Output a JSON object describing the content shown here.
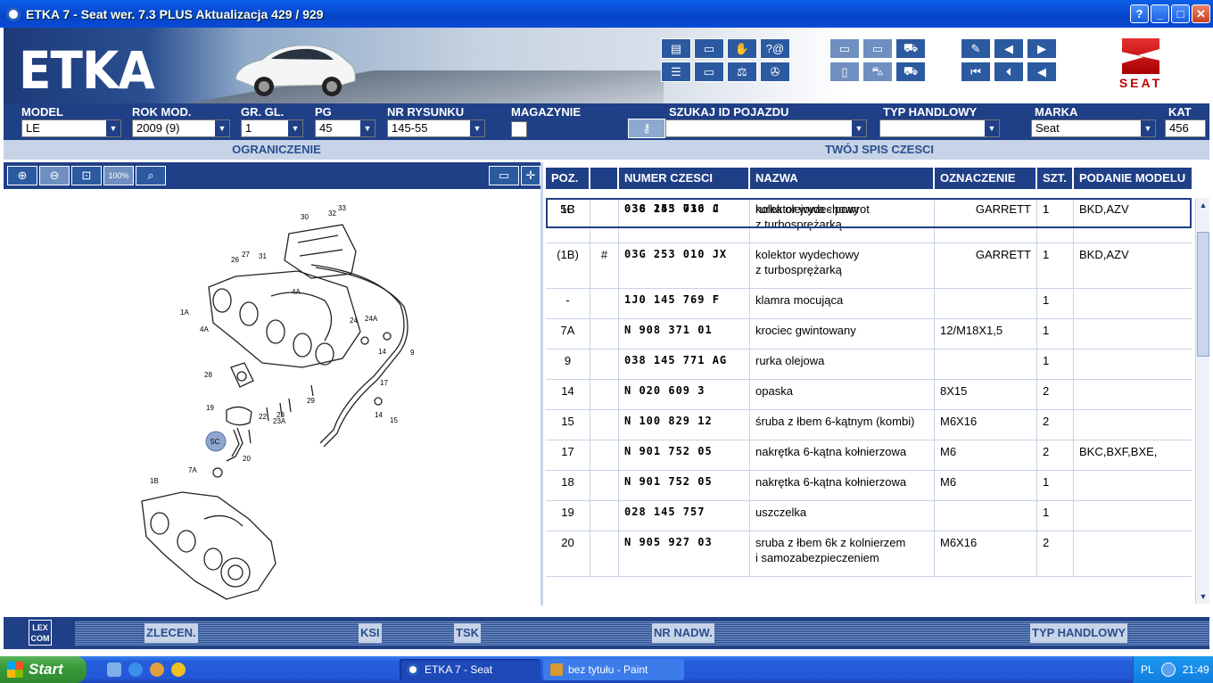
{
  "window": {
    "title": "ETKA 7 - Seat wer. 7.3 PLUS Aktualizacja 429 / 929",
    "help": "?",
    "minimize": "_",
    "maximize": "□",
    "close": "✕"
  },
  "banner": {
    "logo": "ETKA",
    "brand_word": "SEAT"
  },
  "selectors": [
    {
      "label": "MODEL",
      "value": "LE"
    },
    {
      "label": "ROK MOD.",
      "value": "2009 (9)"
    },
    {
      "label": "GR. GL.",
      "value": "1"
    },
    {
      "label": "PG",
      "value": "45"
    },
    {
      "label": "NR RYSUNKU",
      "value": "145-55"
    },
    {
      "label": "MAGAZYNIE",
      "value": ""
    },
    {
      "label": "SZUKAJ ID POJAZDU",
      "value": ""
    },
    {
      "label": "TYP HANDLOWY",
      "value": ""
    },
    {
      "label": "MARKA",
      "value": "Seat"
    },
    {
      "label": "KAT",
      "value": "456"
    }
  ],
  "subheaders": {
    "left": "OGRANICZENIE",
    "right": "TWÓJ SPIS CZESCI"
  },
  "zoom_tools": {
    "zoom100": "100%"
  },
  "table": {
    "headers": [
      "POZ.",
      "",
      "NUMER CZESCI",
      "NAZWA",
      "OZNACZENIE",
      "SZT.",
      "PODANIE MODELU"
    ],
    "rows": [
      {
        "poz": "1B",
        "mark": "",
        "num": "03G 253 010 J",
        "name": "kolektor wydechowy",
        "name2": "z turbosprężarką",
        "oznaczenie": "GARRETT",
        "szt": "1",
        "model": "BKD,AZV"
      },
      {
        "poz": "(1B)",
        "mark": "#",
        "num": "03G 253 010 JX",
        "name": "kolektor wydechowy",
        "name2": "z turbosprężarką",
        "oznaczenie": "GARRETT",
        "szt": "1",
        "model": "BKD,AZV"
      },
      {
        "poz": "-",
        "mark": "",
        "num": "1J0 145 769 F",
        "name": "klamra mocująca",
        "name2": "",
        "oznaczenie": "",
        "szt": "1",
        "model": ""
      },
      {
        "poz": "5C",
        "mark": "",
        "num": "038 145 736 C",
        "name": "rurka olejowa - powrot",
        "name2": "",
        "oznaczenie": "",
        "szt": "1",
        "model": ""
      },
      {
        "poz": "7A",
        "mark": "",
        "num": "N 908 371 01",
        "name": "krociec gwintowany",
        "name2": "",
        "oznaczenie": "12/M18X1,5",
        "szt": "1",
        "model": ""
      },
      {
        "poz": "9",
        "mark": "",
        "num": "038 145 771 AG",
        "name": "rurka olejowa",
        "name2": "",
        "oznaczenie": "",
        "szt": "1",
        "model": ""
      },
      {
        "poz": "14",
        "mark": "",
        "num": "N 020 609 3",
        "name": "opaska",
        "name2": "",
        "oznaczenie": "8X15",
        "szt": "2",
        "model": ""
      },
      {
        "poz": "15",
        "mark": "",
        "num": "N 100 829 12",
        "name": "śruba z łbem 6-kątnym (kombi)",
        "name2": "",
        "oznaczenie": "M6X16",
        "szt": "2",
        "model": ""
      },
      {
        "poz": "17",
        "mark": "",
        "num": "N 901 752 05",
        "name": "nakrętka 6-kątna kołnierzowa",
        "name2": "",
        "oznaczenie": "M6",
        "szt": "2",
        "model": "BKC,BXF,BXE,"
      },
      {
        "poz": "18",
        "mark": "",
        "num": "N 901 752 05",
        "name": "nakrętka 6-kątna kołnierzowa",
        "name2": "",
        "oznaczenie": "M6",
        "szt": "1",
        "model": ""
      },
      {
        "poz": "19",
        "mark": "",
        "num": "028 145 757",
        "name": "uszczelka",
        "name2": "",
        "oznaczenie": "",
        "szt": "1",
        "model": ""
      },
      {
        "poz": "20",
        "mark": "",
        "num": "N 905 927 03",
        "name": "sruba z łbem 6k z kolnierzem",
        "name2": "i samozabezpieczeniem",
        "oznaczenie": "M6X16",
        "szt": "2",
        "model": ""
      }
    ]
  },
  "diagram_labels": [
    "30",
    "32",
    "33",
    "26",
    "27",
    "31",
    "1A",
    "4A",
    "4A",
    "24",
    "24A",
    "14",
    "9",
    "28",
    "5C",
    "20",
    "7A",
    "19",
    "22",
    "23",
    "23A",
    "29",
    "17",
    "14",
    "15",
    "1B"
  ],
  "bottom": {
    "lexcom": "LEX COM",
    "zlecen": "ZLECEN.",
    "ksi": "KSI",
    "tsk": "TSK",
    "nr_nadw": "NR NADW.",
    "typ_handlowy": "TYP HANDLOWY"
  },
  "taskbar": {
    "start": "Start",
    "task1": "ETKA 7 - Seat",
    "task2": "bez tytułu - Paint",
    "lang": "PL",
    "time": "21:49"
  },
  "colors": {
    "accent": "#1f3f86",
    "light": "#c7d3e7",
    "seat_red": "#c00000"
  }
}
